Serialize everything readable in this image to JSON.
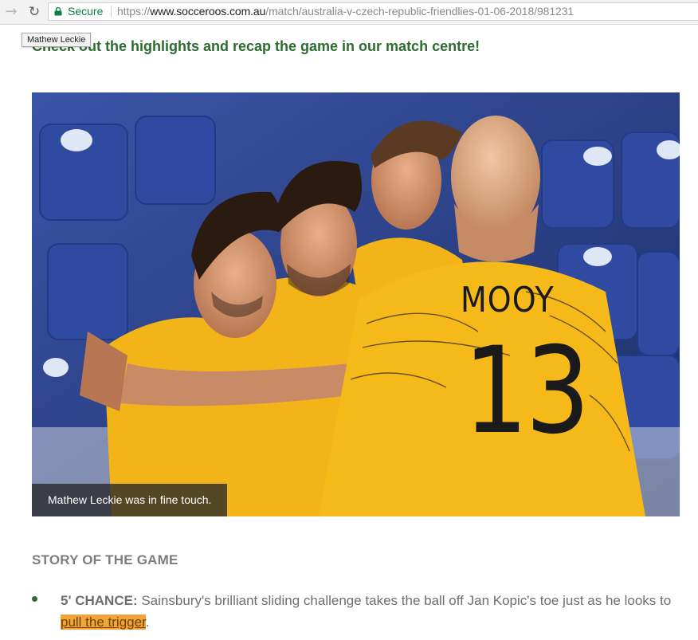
{
  "browser": {
    "secure_label": "Secure",
    "url_scheme": "https://",
    "url_host": "www.socceroos.com.au",
    "url_path": "/match/australia-v-czech-republic-friendlies-01-06-2018/981231",
    "icons": {
      "forward": "forward-arrow-icon",
      "reload": "reload-icon",
      "lock": "lock-icon"
    }
  },
  "tooltip": "Mathew Leckie",
  "headline_link": "Check out the highlights and recap the game in our match centre!",
  "photo": {
    "caption": "Mathew Leckie was in fine touch.",
    "jersey_name": "MOOY",
    "jersey_number": "13"
  },
  "story": {
    "title": "STORY OF THE GAME",
    "events": [
      {
        "time": "5' CHANCE:",
        "text_before": "Sainsbury's brilliant sliding challenge takes the ball off Jan Kopic's toe just as he looks to ",
        "link": "pull the trigger",
        "text_after": "."
      }
    ]
  },
  "colors": {
    "accent_green": "#2e6b2f",
    "highlight": "#f0a43a",
    "jersey_yellow": "#f2b418",
    "stadium_blue": "#2b3f86"
  }
}
